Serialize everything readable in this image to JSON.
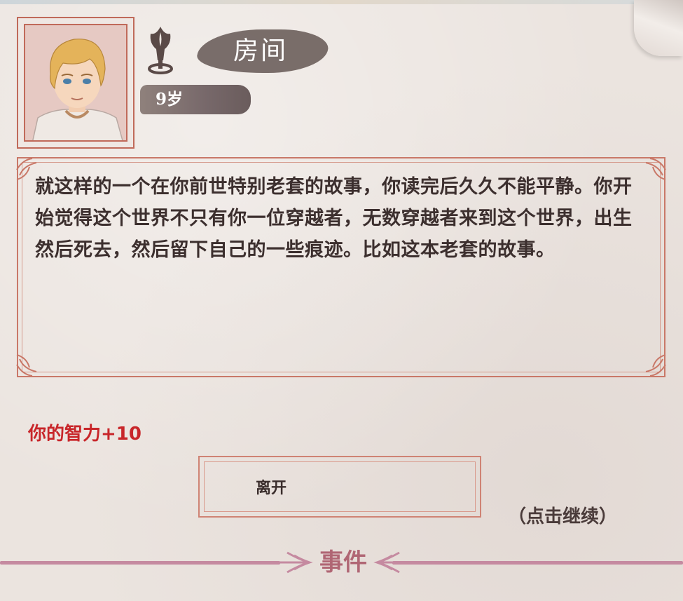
{
  "header": {
    "location_title": "房间",
    "age_label": "9岁",
    "portrait": "portrait-avatar-icon",
    "emblem": "flower-emblem-icon"
  },
  "event": {
    "story_text": "就这样的一个在你前世特别老套的故事，你读完后久久不能平静。你开始觉得这个世界不只有你一位穿越者，无数穿越者来到这个世界，出生然后死去，然后留下自己的一些痕迹。比如这本老套的故事。",
    "result_text": "你的智力+10",
    "choice_label": "离开",
    "continue_hint": "（点击继续）",
    "banner_title": "事件"
  },
  "colors": {
    "frame_accent": "#c97868",
    "result_red": "#c8262a",
    "banner_pink": "#c58aa0",
    "text_dark": "#3c2f2e"
  }
}
